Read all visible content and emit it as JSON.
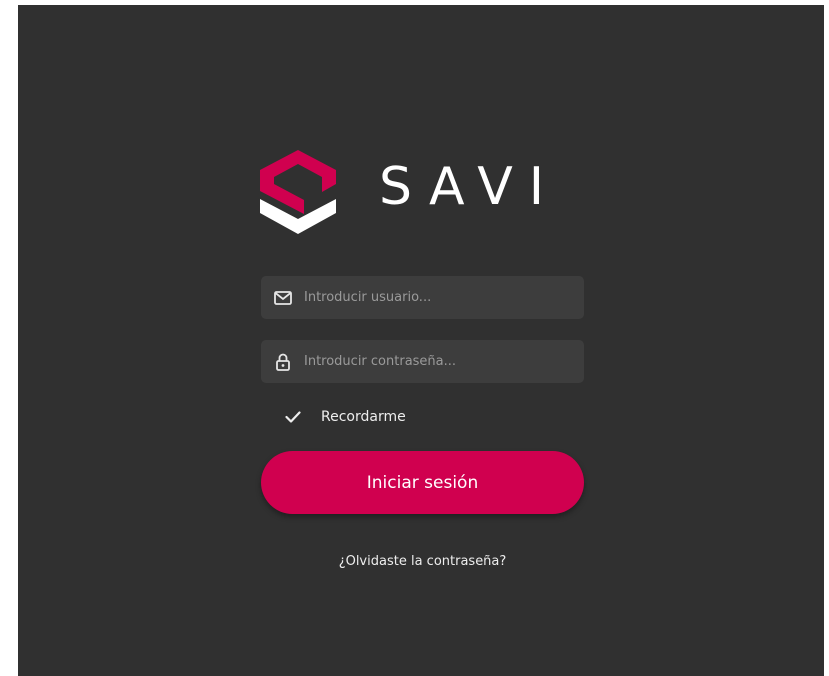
{
  "brand": {
    "name": "SAVI",
    "accent_color": "#d0004f",
    "background_color": "#303030",
    "field_color": "#3d3d3d"
  },
  "login": {
    "username_placeholder": "Introducir usuario...",
    "username_icon": "mail-icon",
    "password_placeholder": "Introducir contraseña...",
    "password_icon": "lock-icon",
    "remember_label": "Recordarme",
    "remember_checked": true,
    "submit_label": "Iniciar sesión",
    "forgot_label": "¿Olvidaste la contraseña?"
  }
}
